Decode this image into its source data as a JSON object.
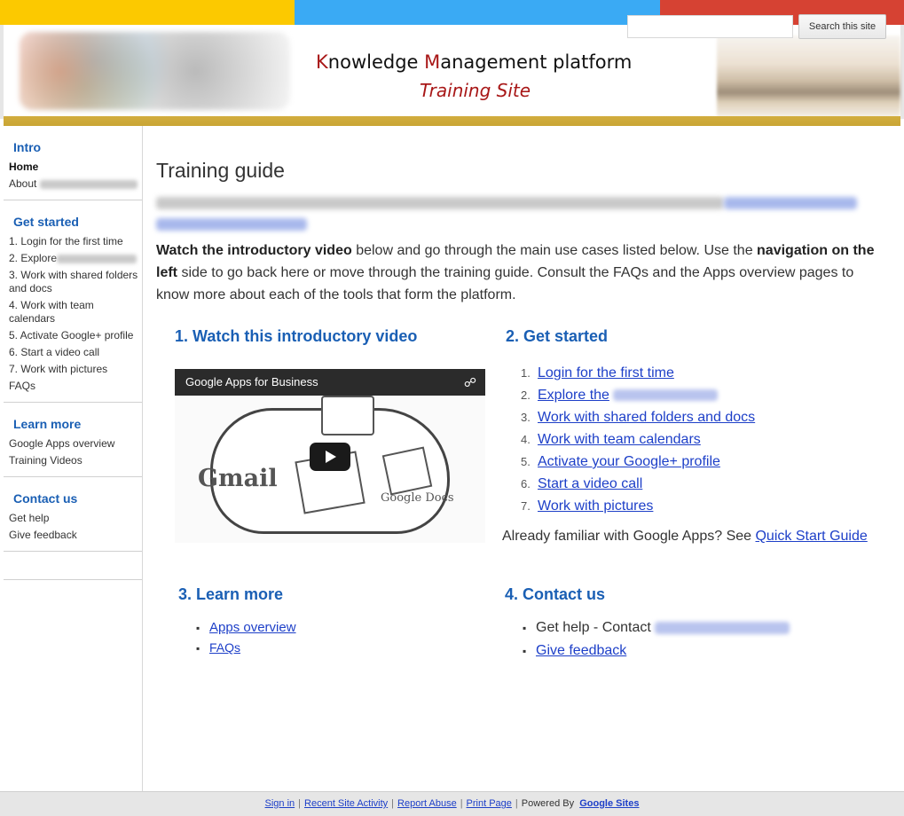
{
  "header": {
    "title_parts": [
      {
        "cap": "K",
        "rest": "nowledge "
      },
      {
        "cap": "M",
        "rest": "anagement platform"
      }
    ],
    "subtitle": "Training Site",
    "search_placeholder": "",
    "search_button": "Search this site",
    "stripe_colors": [
      "#fcc900",
      "#3aaaf4",
      "#d64233"
    ]
  },
  "sidebar": {
    "sections": [
      {
        "heading": "Intro",
        "items": [
          {
            "label": "Home",
            "active": true
          },
          {
            "label": "About",
            "blur": 110
          }
        ]
      },
      {
        "heading": "Get started",
        "items": [
          {
            "label": "1. Login for the first time"
          },
          {
            "label": "2. Explore",
            "blur": 92
          },
          {
            "label": "3. Work with shared folders and docs"
          },
          {
            "label": "4. Work with team calendars"
          },
          {
            "label": "5. Activate Google+ profile"
          },
          {
            "label": "6. Start a video call"
          },
          {
            "label": "7. Work with pictures"
          },
          {
            "label": "FAQs"
          }
        ]
      },
      {
        "heading": "Learn more",
        "items": [
          {
            "label": "Google Apps overview"
          },
          {
            "label": "Training Videos"
          }
        ]
      },
      {
        "heading": "Contact us",
        "items": [
          {
            "label": "Get help"
          },
          {
            "label": "Give feedback"
          }
        ]
      }
    ]
  },
  "main": {
    "page_title": "Training guide",
    "intro": {
      "bold1": "Watch the introductory video",
      "text1": " below and go through the main use cases listed below. Use the ",
      "bold2": "navigation on the left",
      "text2": " side to go back here or move through the training guide. Consult the FAQs and the Apps overview pages to know more about each of the tools that form the platform."
    },
    "section1": {
      "heading": "1. Watch this introductory video",
      "video_title": "Google Apps for Business",
      "gmail_text": "Gmail",
      "docs_text": "Google Docs"
    },
    "section2": {
      "heading": "2. Get started",
      "steps": [
        {
          "num": "1.",
          "label": "Login for the first time"
        },
        {
          "num": "2.",
          "label": "Explore the",
          "blur": true
        },
        {
          "num": "3.",
          "label": "Work with shared folders and docs"
        },
        {
          "num": "4.",
          "label": "Work with team calendars"
        },
        {
          "num": "5.",
          "label": "Activate your Google+ profile"
        },
        {
          "num": "6.",
          "label": "Start a video call"
        },
        {
          "num": "7.",
          "label": "Work with pictures"
        }
      ],
      "familiar_text": "Already familiar with Google Apps? See ",
      "quick_start_link": "Quick Start Guide"
    },
    "section3": {
      "heading": "3. Learn more",
      "links": [
        "Apps overview",
        "FAQs"
      ]
    },
    "section4": {
      "heading": "4. Contact us",
      "get_help_text": "Get help - Contact",
      "feedback_link": "Give feedback"
    }
  },
  "footer": {
    "links": [
      "Sign in",
      "Recent Site Activity",
      "Report Abuse",
      "Print Page"
    ],
    "powered_by": "Powered By",
    "google_sites": "Google Sites"
  }
}
